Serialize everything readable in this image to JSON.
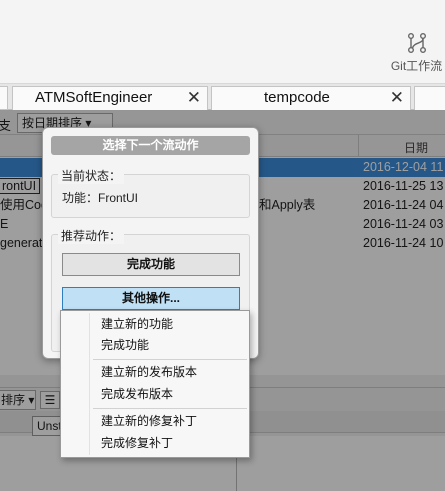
{
  "toolbar": {
    "git_flow_label": "Git工作流"
  },
  "tabs": [
    {
      "label": "ATMSoftEngineer",
      "close": "✕"
    },
    {
      "label": "tempcode",
      "close": "✕"
    }
  ],
  "filter": {
    "fragment": "支",
    "sort_value": "按日期排序 ▾"
  },
  "grid": {
    "date_header": "日期",
    "rows": [
      {
        "msg": "",
        "date": "2016-12-04 11",
        "selected": true
      },
      {
        "msg": "rontUI",
        "date": "2016-11-25 13",
        "selected": false
      },
      {
        "msg": "使用Code",
        "msg_right": "和Apply表",
        "date": "2016-11-24 04",
        "selected": false
      },
      {
        "msg": "E",
        "date": "2016-11-24 03",
        "selected": false
      },
      {
        "msg": "generat",
        "date": "2016-11-24 10",
        "selected": false
      }
    ]
  },
  "bottom": {
    "sort_fragment": "排序 ▾",
    "list_icon": "☰",
    "unstaged_label": "Unst"
  },
  "dialog": {
    "title": "选择下一个流动作",
    "state_label": "当前状态：",
    "state_text": "功能：FrontUI",
    "actions_label": "推荐动作：",
    "finish_feature_button": "完成功能",
    "other_actions_button": "其他操作..."
  },
  "menu": {
    "items": [
      "建立新的功能",
      "完成功能",
      "建立新的发布版本",
      "完成发布版本",
      "建立新的修复补丁",
      "完成修复补丁"
    ]
  }
}
